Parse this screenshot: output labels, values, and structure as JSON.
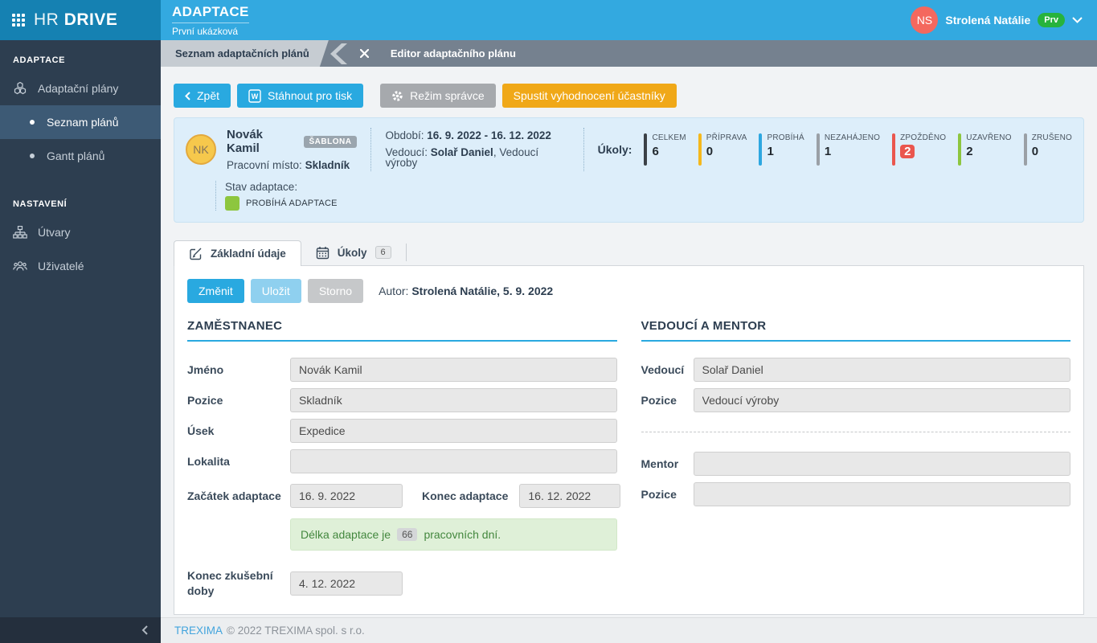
{
  "brand": {
    "hr": "HR",
    "drive": "DRIVE"
  },
  "header": {
    "title": "ADAPTACE",
    "subtitle": "První ukázková",
    "user_initials": "NS",
    "user_name": "Strolená Natálie",
    "user_badge": "Prv"
  },
  "sidebar": {
    "section_adaptace": "ADAPTACE",
    "item_plans": "Adaptační plány",
    "item_seznam": "Seznam plánů",
    "item_gantt": "Gantt plánů",
    "section_nastaveni": "NASTAVENÍ",
    "item_utvary": "Útvary",
    "item_uzivatele": "Uživatelé"
  },
  "tabbar": {
    "active_tab": "Seznam adaptačních plánů",
    "editor_tab": "Editor adaptačního plánu"
  },
  "toolbar": {
    "back": "Zpět",
    "print": "Stáhnout pro tisk",
    "print_icon_letter": "W",
    "admin": "Režim správce",
    "evaluate": "Spustit vyhodnocení účastníky"
  },
  "summary": {
    "initials": "NK",
    "name": "Novák Kamil",
    "badge": "ŠABLONA",
    "job_label": "Pracovní místo:",
    "job_value": "Skladník",
    "period_label": "Období:",
    "period_value": "16. 9. 2022 - 16. 12. 2022",
    "lead_label": "Vedoucí:",
    "lead_value": "Solař Daniel",
    "lead_suffix": ", Vedoucí výroby",
    "status_label": "Stav adaptace:",
    "status_value": "PROBÍHÁ ADAPTACE",
    "status_color": "#8dc63f"
  },
  "tasks": {
    "label": "Úkoly:",
    "counters": [
      {
        "label": "CELKEM",
        "value": "6",
        "color": "#3b4046"
      },
      {
        "label": "PŘÍPRAVA",
        "value": "0",
        "color": "#f5b81c"
      },
      {
        "label": "PROBÍHÁ",
        "value": "1",
        "color": "#2da7e0"
      },
      {
        "label": "NEZAHÁJENO",
        "value": "1",
        "color": "#9aa0a6"
      },
      {
        "label": "ZPOŽDĚNO",
        "value": "2",
        "color": "#ea564e"
      },
      {
        "label": "UZAVŘENO",
        "value": "2",
        "color": "#8dc63f"
      },
      {
        "label": "ZRUŠENO",
        "value": "0",
        "color": "#9aa0a6"
      }
    ]
  },
  "form_tabs": {
    "basic_label": "Základní údaje",
    "tasks_label": "Úkoly",
    "tasks_count": "6"
  },
  "form": {
    "buttons": {
      "change": "Změnit",
      "save": "Uložit",
      "cancel": "Storno"
    },
    "author_label": "Autor:",
    "author_value": "Strolená Natálie, 5. 9. 2022",
    "employee": {
      "heading": "ZAMĚSTNANEC",
      "name_label": "Jméno",
      "name_value": "Novák Kamil",
      "position_label": "Pozice",
      "position_value": "Skladník",
      "unit_label": "Úsek",
      "unit_value": "Expedice",
      "location_label": "Lokalita",
      "location_value": "",
      "start_label": "Začátek adaptace",
      "start_value": "16. 9. 2022",
      "end_label": "Konec adaptace",
      "end_value": "16. 12. 2022",
      "duration_prefix": "Délka adaptace je",
      "duration_value": "66",
      "duration_suffix": "pracovních dní.",
      "trial_label": "Konec zkušební doby",
      "trial_value": "4. 12. 2022"
    },
    "mentor": {
      "heading": "VEDOUCÍ A MENTOR",
      "lead_label": "Vedoucí",
      "lead_value": "Solař Daniel",
      "lead_position_label": "Pozice",
      "lead_position_value": "Vedoucí výroby",
      "mentor_label": "Mentor",
      "mentor_value": "",
      "mentor_position_label": "Pozice",
      "mentor_position_value": ""
    }
  },
  "footer": {
    "link": "TREXIMA",
    "text": "© 2022 TREXIMA spol. s r.o."
  },
  "colors": {
    "header_blue": "#33a9e0",
    "logo_blue": "#1581b2",
    "sidebar_navy": "#2d3e50",
    "accent_blue": "#29a9e0",
    "warning_amber": "#f0a818",
    "danger_red": "#ea564e",
    "success_green": "#8dc63f"
  }
}
